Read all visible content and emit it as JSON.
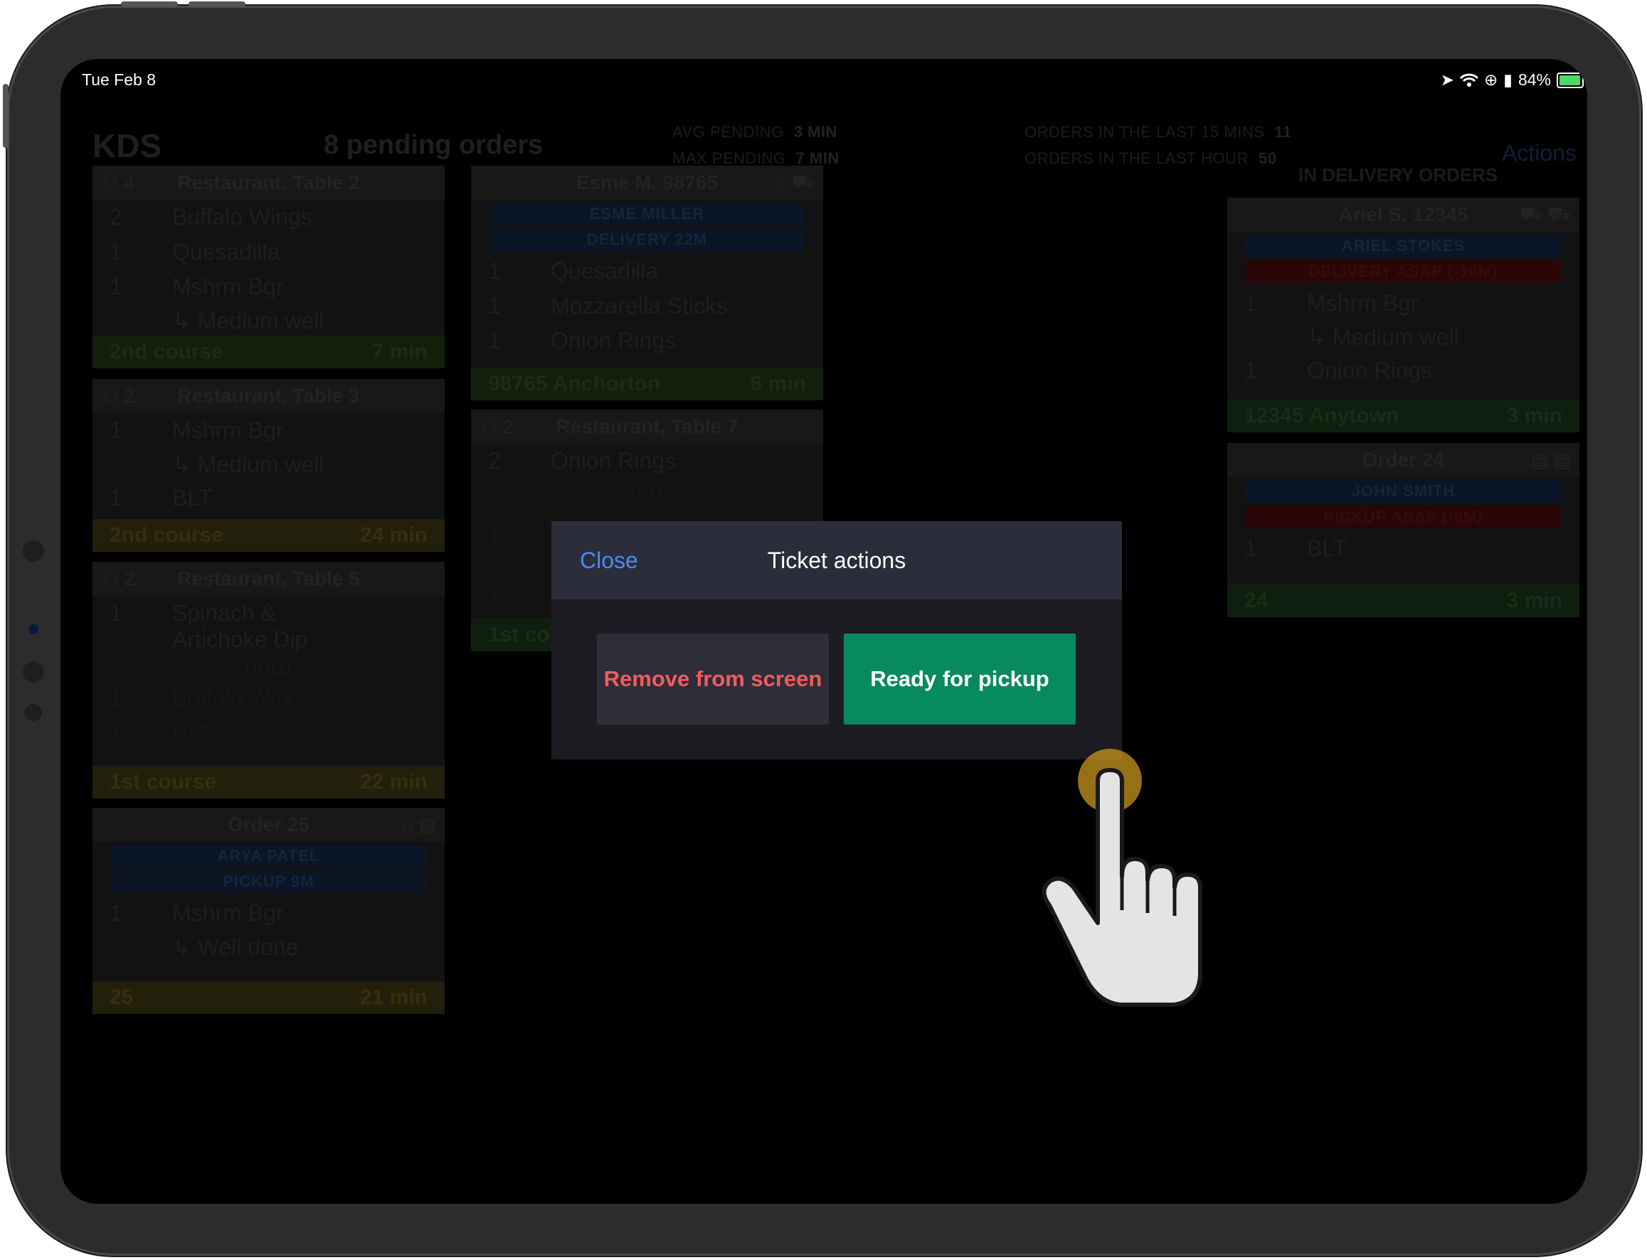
{
  "status_bar": {
    "date": "Tue Feb 8",
    "battery": "84%"
  },
  "header": {
    "title": "KDS",
    "pending": "8 pending orders",
    "avg_pending_label": "AVG PENDING",
    "avg_pending_value": "3 MIN",
    "max_pending_label": "MAX PENDING",
    "max_pending_value": "7 MIN",
    "orders15_label": "ORDERS IN THE LAST 15 MINS",
    "orders15_value": "11",
    "ordershour_label": "ORDERS IN THE LAST HOUR",
    "ordershour_value": "50",
    "actions": "Actions"
  },
  "col1": {
    "t1": {
      "guests": "4",
      "title": "Restaurant, Table 2",
      "items": [
        {
          "q": "2",
          "n": "Buffalo Wings"
        },
        {
          "q": "1",
          "n": "Quesadilla"
        },
        {
          "q": "1",
          "n": "Mshrm Bgr"
        }
      ],
      "mod": "↳ Medium well",
      "foot_l": "2nd course",
      "foot_r": "7 min"
    },
    "t2": {
      "guests": "2",
      "title": "Restaurant, Table 3",
      "items": [
        {
          "q": "1",
          "n": "Mshrm Bgr"
        },
        {
          "q": "1",
          "n": "BLT"
        }
      ],
      "mod": "↳ Medium well",
      "foot_l": "2nd course",
      "foot_r": "24 min"
    },
    "t3": {
      "guests": "2",
      "title": "Restaurant, Table 5",
      "items": [
        {
          "q": "1",
          "n": "Spinach &"
        },
        {
          "q": "",
          "n": "Artichoke Dip"
        },
        {
          "q": "1",
          "n": "Buffalo Wings"
        },
        {
          "q": "1",
          "n": "BLT"
        }
      ],
      "hold": "HOLD",
      "foot_l": "1st course",
      "foot_r": "22 min"
    },
    "t4": {
      "title": "Order 25",
      "pill1": "ARYA  PATEL",
      "pill2": "PICKUP 9M",
      "items": [
        {
          "q": "1",
          "n": "Mshrm Bgr"
        }
      ],
      "mod": "↳ Well done",
      "foot_l": "25",
      "foot_r": "21 min"
    }
  },
  "col2": {
    "t1": {
      "title": "Esme  M. 98765",
      "pill1": "ESME  MILLER",
      "pill2": "DELIVERY 22M",
      "items": [
        {
          "q": "1",
          "n": "Quesadilla"
        },
        {
          "q": "1",
          "n": "Mozzarella Sticks"
        },
        {
          "q": "1",
          "n": "Onion Rings"
        }
      ],
      "foot_l": "98765 Anchorton",
      "foot_r": "6 min"
    },
    "t2": {
      "guests": "2",
      "title": "Restaurant, Table 7",
      "items": [
        {
          "q": "2",
          "n": "Onion Rings"
        },
        {
          "q": "1",
          "n": ""
        },
        {
          "q": "1",
          "n": ""
        }
      ],
      "hold": "HOLD",
      "foot_l": "1st co"
    }
  },
  "delivery": {
    "section_title": "IN DELIVERY ORDERS",
    "t1": {
      "title": "Ariel  S. 12345",
      "pill1": "ARIEL  STOKES",
      "pill2": "DELIVERY ASAP (-10M)",
      "items": [
        {
          "q": "1",
          "n": "Mshrm Bgr"
        },
        {
          "q": "1",
          "n": "Onion Rings"
        }
      ],
      "mod": "↳ Medium well",
      "foot_l": "12345 Anytown",
      "foot_r": "3 min"
    },
    "t2": {
      "title": "Order 24",
      "pill1": "JOHN SMITH",
      "pill2": "PICKUP ASAP (-8M)",
      "items": [
        {
          "q": "1",
          "n": "BLT"
        }
      ],
      "foot_l": "24",
      "foot_r": "3 min"
    }
  },
  "modal": {
    "close": "Close",
    "title": "Ticket actions",
    "remove": "Remove from screen",
    "ready": "Ready for pickup"
  },
  "colors": {
    "accent_blue": "#4a8cf7",
    "ready_green": "#078a5f",
    "remove_red": "#f25c5c"
  }
}
